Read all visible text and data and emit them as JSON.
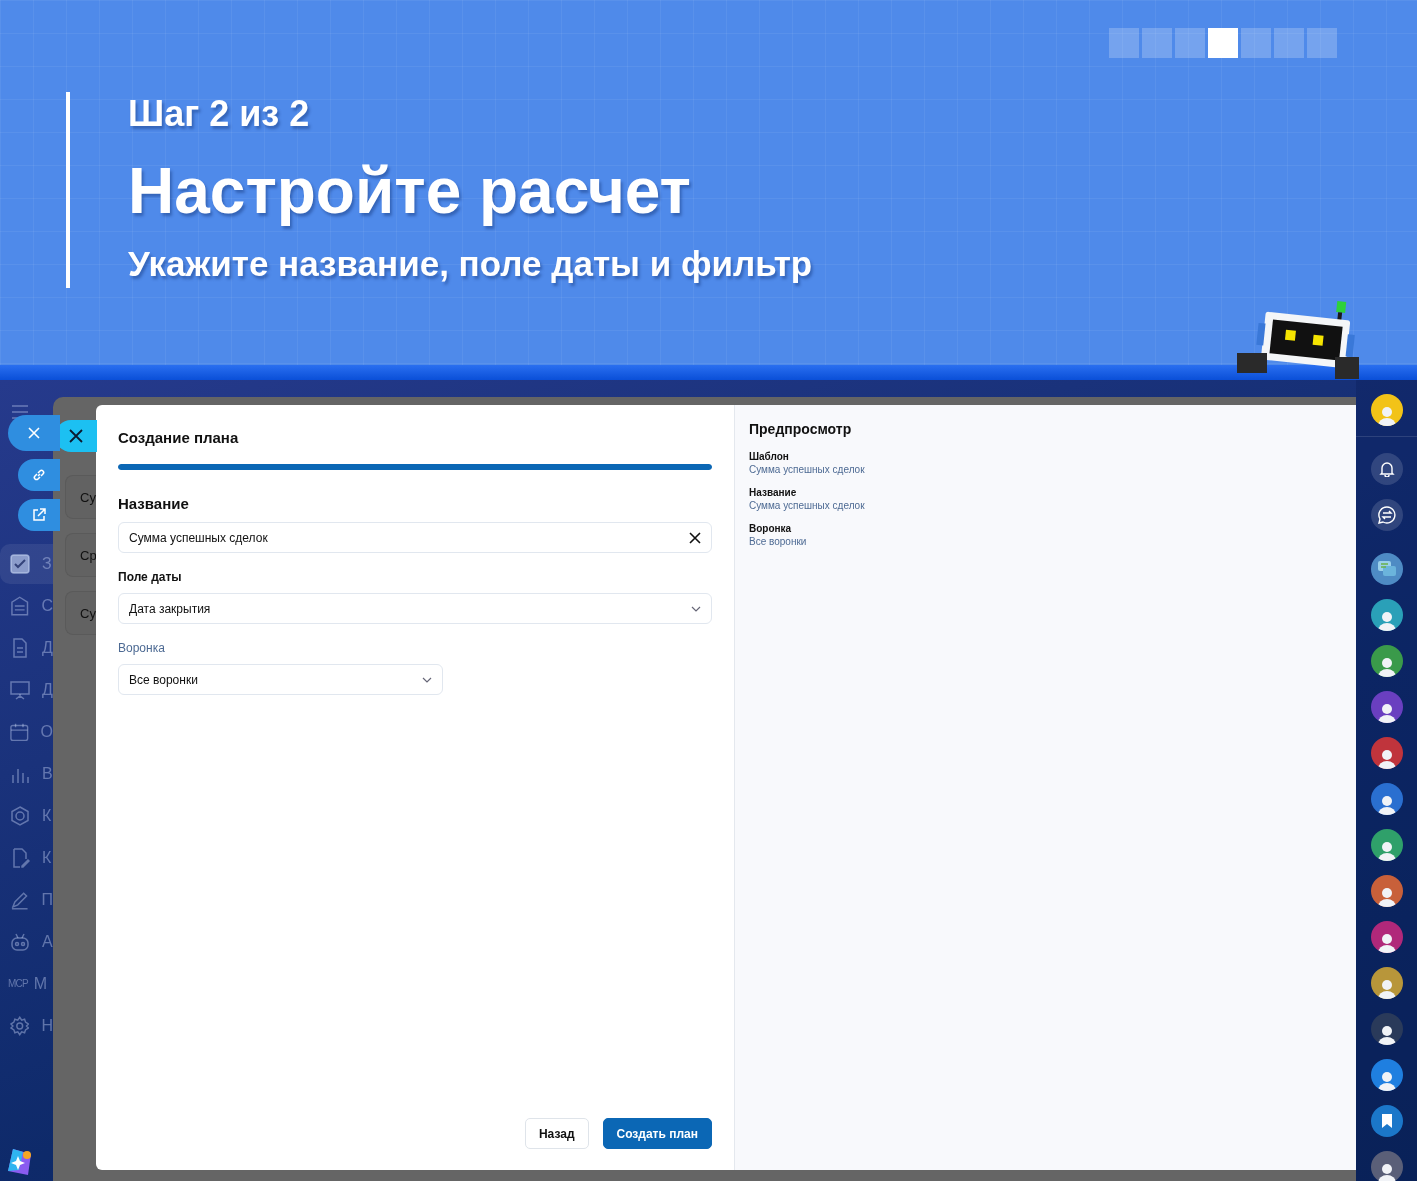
{
  "slide": {
    "step_text": "Шаг 2 из 2",
    "title": "Настройте расчет",
    "subtitle": "Укажите название, поле даты и фильтр",
    "pager": [
      {
        "selected": false
      },
      {
        "selected": false
      },
      {
        "selected": false
      },
      {
        "selected": true
      },
      {
        "selected": false
      },
      {
        "selected": false
      },
      {
        "selected": false
      }
    ]
  },
  "sidebar": {
    "items": [
      {
        "kind": "checkbox",
        "label": "З",
        "selected": true
      },
      {
        "kind": "building",
        "label": "С",
        "selected": false
      },
      {
        "kind": "document",
        "label": "Д",
        "selected": false
      },
      {
        "kind": "board",
        "label": "Д",
        "selected": false
      },
      {
        "kind": "calendar",
        "label": "О",
        "selected": false
      },
      {
        "kind": "chart",
        "label": "В",
        "selected": false
      },
      {
        "kind": "hexagon",
        "label": "К",
        "selected": false
      },
      {
        "kind": "edit",
        "label": "К",
        "selected": false
      },
      {
        "kind": "pencil",
        "label": "П",
        "selected": false
      },
      {
        "kind": "robot",
        "label": "А",
        "selected": false
      },
      {
        "kind": "mcp",
        "icon_text": "MCP",
        "label": "М",
        "selected": false
      },
      {
        "kind": "gear",
        "label": "Н",
        "selected": false
      }
    ]
  },
  "floating_actions": [
    {
      "kind": "close"
    },
    {
      "kind": "link"
    },
    {
      "kind": "external"
    }
  ],
  "background_cards": [
    {
      "text": "Су"
    },
    {
      "text": "Ср"
    },
    {
      "text": "Су"
    }
  ],
  "dialog": {
    "title": "Создание плана",
    "progress": {
      "level": 1
    },
    "name_label": "Название",
    "name_value": "Сумма успешных сделок",
    "date_label": "Поле даты",
    "date_value": "Дата закрытия",
    "funnel_label": "Воронка",
    "funnel_value": "Все воронки",
    "buttons": [
      {
        "label": "Назад",
        "kind": "secondary"
      },
      {
        "label": "Создать план",
        "kind": "primary"
      }
    ]
  },
  "preview": {
    "title": "Предпросмотр",
    "items": [
      {
        "label": "Шаблон",
        "value": "Сумма успешных сделок"
      },
      {
        "label": "Название",
        "value": "Сумма успешных сделок"
      },
      {
        "label": "Воронка",
        "value": "Все воронки"
      }
    ]
  },
  "right_bar": {
    "items": [
      {
        "kind": "avatar",
        "color": "#f2c318"
      },
      {
        "kind": "separator"
      },
      {
        "kind": "bell"
      },
      {
        "kind": "swap"
      },
      {
        "kind": "gap"
      },
      {
        "kind": "chat"
      },
      {
        "kind": "avatar",
        "color": "#2aa0b8"
      },
      {
        "kind": "avatar",
        "color": "#3a9a4a"
      },
      {
        "kind": "avatar",
        "color": "#6a3fc0"
      },
      {
        "kind": "avatar",
        "color": "#c0343c"
      },
      {
        "kind": "avatar",
        "color": "#2a6fd0"
      },
      {
        "kind": "avatar",
        "color": "#2fa06a"
      },
      {
        "kind": "avatar",
        "color": "#c8603a"
      },
      {
        "kind": "avatar",
        "color": "#b0287a"
      },
      {
        "kind": "avatar",
        "color": "#b8963a"
      },
      {
        "kind": "avatar",
        "color": "#2a3a5a"
      },
      {
        "kind": "avatar",
        "color": "#1f7fe0"
      },
      {
        "kind": "bookmark"
      },
      {
        "kind": "avatar",
        "color": "#5a5f78"
      }
    ]
  }
}
